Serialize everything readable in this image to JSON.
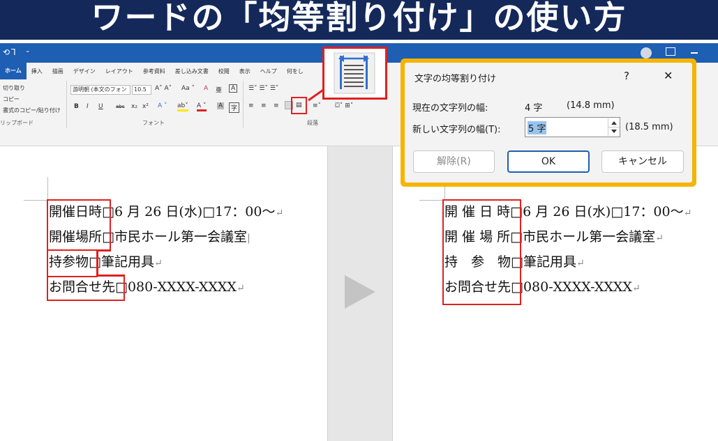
{
  "banner": {
    "title": "ワードの「均等割り付け」の使い方"
  },
  "window": {
    "tabs": [
      "ホーム",
      "挿入",
      "描画",
      "デザイン",
      "レイアウト",
      "参考資料",
      "差し込み文書",
      "校閲",
      "表示",
      "ヘルプ",
      "何をし"
    ],
    "quick_access": [
      "⟲",
      "Ꞁ",
      "⌄"
    ],
    "clipboard": {
      "cut": "切り取り",
      "copy": "コピー",
      "format_painter": "書式のコピー/貼り付け",
      "group_label": "リップボード"
    },
    "font": {
      "name": "游明朝 (本文のフォン",
      "size": "10.5",
      "group_label": "フォント",
      "buttons": [
        "B",
        "I",
        "U",
        "abc",
        "x₂",
        "x²"
      ]
    },
    "paragraph": {
      "group_label": "段落"
    }
  },
  "doc_left": {
    "lines": [
      {
        "label": "開催日時",
        "sep": "□",
        "value": "6 月 26 日(水)□17：00〜"
      },
      {
        "label": "開催場所",
        "sep": "□",
        "value": "市民ホール第一会議室"
      },
      {
        "label": "持参物",
        "sep": "□",
        "value": "筆記用具"
      },
      {
        "label": "お問合せ先",
        "sep": "□",
        "value": "080-XXXX-XXXX"
      }
    ]
  },
  "doc_right": {
    "lines": [
      {
        "label": "開 催 日 時",
        "sep": "□",
        "value": "6 月 26 日(水)□17：00〜"
      },
      {
        "label": "開 催 場 所",
        "sep": "□",
        "value": "市民ホール第一会議室"
      },
      {
        "label": "持　参　物",
        "sep": "□",
        "value": "筆記用具"
      },
      {
        "label": "お問合せ先",
        "sep": "□",
        "value": "080-XXXX-XXXX"
      }
    ]
  },
  "para_mark": "↵",
  "dialog": {
    "title": "文字の均等割り付け",
    "help": "?",
    "close": "✕",
    "current_label": "現在の文字列の幅:",
    "current_value": "4 字",
    "current_mm": "(14.8 mm)",
    "new_label": "新しい文字列の幅(T):",
    "new_value": "5 字",
    "new_mm": "(18.5 mm)",
    "btn_release": "解除(R)",
    "btn_ok": "OK",
    "btn_cancel": "キャンセル"
  },
  "colors": {
    "banner": "#14285a",
    "word_blue": "#1e5eb3",
    "highlight_red": "#e02020",
    "dialog_frame": "#f6b400"
  }
}
